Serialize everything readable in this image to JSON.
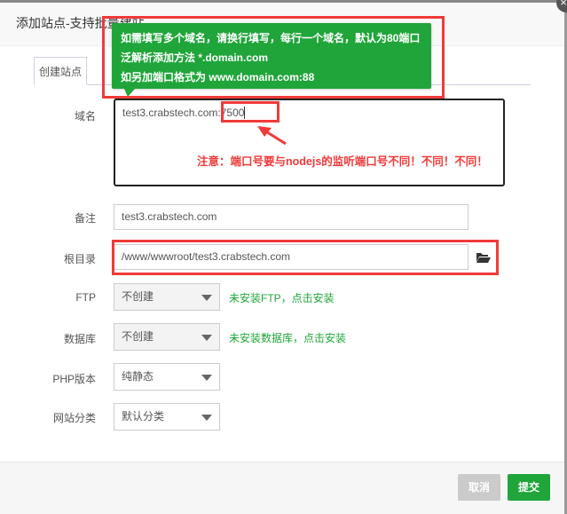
{
  "dialog": {
    "title": "添加站点-支持批量建站",
    "close_icon": "close-icon"
  },
  "tabs": [
    {
      "label": "创建站点"
    }
  ],
  "tooltip": {
    "lines": [
      "如需填写多个域名，请换行填写，每行一个域名，默认为80端口",
      "泛解析添加方法 *.domain.com",
      "如另加端口格式为 www.domain.com:88"
    ],
    "color": "#20a53a"
  },
  "form": {
    "domain": {
      "label": "域名",
      "value_host": "test3.crabstech.com:",
      "value_port": "7500"
    },
    "annotation": "注意：端口号要与nodejs的监听端口号不同！不同！不同！",
    "remark": {
      "label": "备注",
      "value": "test3.crabstech.com"
    },
    "root": {
      "label": "根目录",
      "value": "/www/wwwroot/test3.crabstech.com"
    },
    "ftp": {
      "label": "FTP",
      "value": "不创建",
      "hint": "未安装FTP，点击安装"
    },
    "database": {
      "label": "数据库",
      "value": "不创建",
      "hint": "未安装数据库，点击安装"
    },
    "php": {
      "label": "PHP版本",
      "value": "纯静态"
    },
    "category": {
      "label": "网站分类",
      "value": "默认分类"
    }
  },
  "footer": {
    "cancel": "取消",
    "submit": "提交"
  },
  "colors": {
    "accent": "#20a53a",
    "highlight": "#f03a3a"
  }
}
